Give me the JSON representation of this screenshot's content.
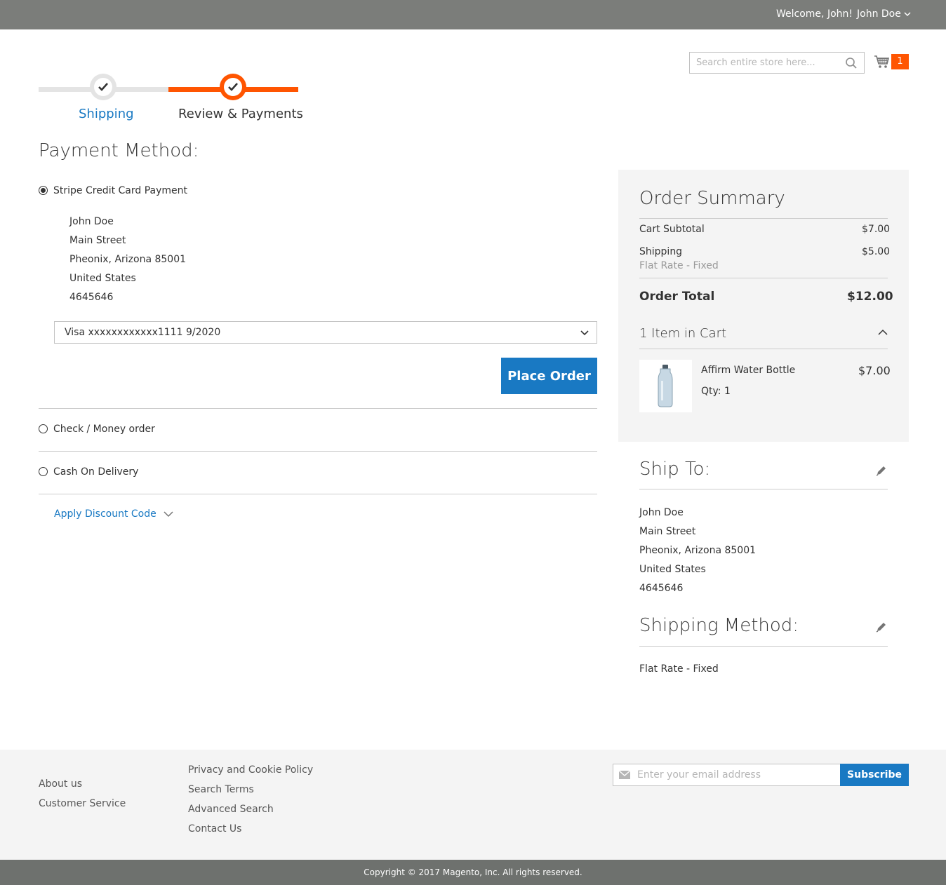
{
  "header": {
    "welcome": "Welcome, John!",
    "user_name": "John Doe",
    "search_placeholder": "Search entire store here...",
    "cart_count": "1"
  },
  "progress": {
    "steps": [
      {
        "label": "Shipping",
        "state": "complete"
      },
      {
        "label": "Review & Payments",
        "state": "active"
      }
    ]
  },
  "payment": {
    "title": "Payment Method:",
    "options": [
      {
        "label": "Stripe Credit Card Payment",
        "selected": true
      },
      {
        "label": "Check / Money order",
        "selected": false
      },
      {
        "label": "Cash On Delivery",
        "selected": false
      }
    ],
    "billing_address": [
      "John Doe",
      "Main Street",
      "Pheonix, Arizona 85001",
      "United States",
      "4645646"
    ],
    "card_selected": "Visa xxxxxxxxxxxx1111 9/2020",
    "place_order": "Place Order",
    "discount": "Apply Discount Code"
  },
  "summary": {
    "title": "Order Summary",
    "subtotal_label": "Cart Subtotal",
    "subtotal_value": "$7.00",
    "shipping_label": "Shipping",
    "shipping_value": "$5.00",
    "shipping_method": "Flat Rate - Fixed",
    "total_label": "Order Total",
    "total_value": "$12.00",
    "items_label": "1 Item in Cart",
    "item": {
      "name": "Affirm Water Bottle",
      "qty": "Qty: 1",
      "price": "$7.00"
    }
  },
  "ship_to": {
    "title": "Ship To:",
    "address": [
      "John Doe",
      "Main Street",
      "Pheonix, Arizona 85001",
      "United States",
      "4645646"
    ]
  },
  "shipping_method": {
    "title": "Shipping Method:",
    "value": "Flat Rate - Fixed"
  },
  "footer": {
    "col1": [
      "About us",
      "Customer Service"
    ],
    "col2": [
      "Privacy and Cookie Policy",
      "Search Terms",
      "Advanced Search",
      "Contact Us"
    ],
    "email_placeholder": "Enter your email address",
    "subscribe": "Subscribe",
    "copyright": "Copyright © 2017 Magento, Inc. All rights reserved."
  },
  "colors": {
    "accent": "#1979c3",
    "progress_active": "#ff5501",
    "topbar": "#7b7d7a"
  }
}
